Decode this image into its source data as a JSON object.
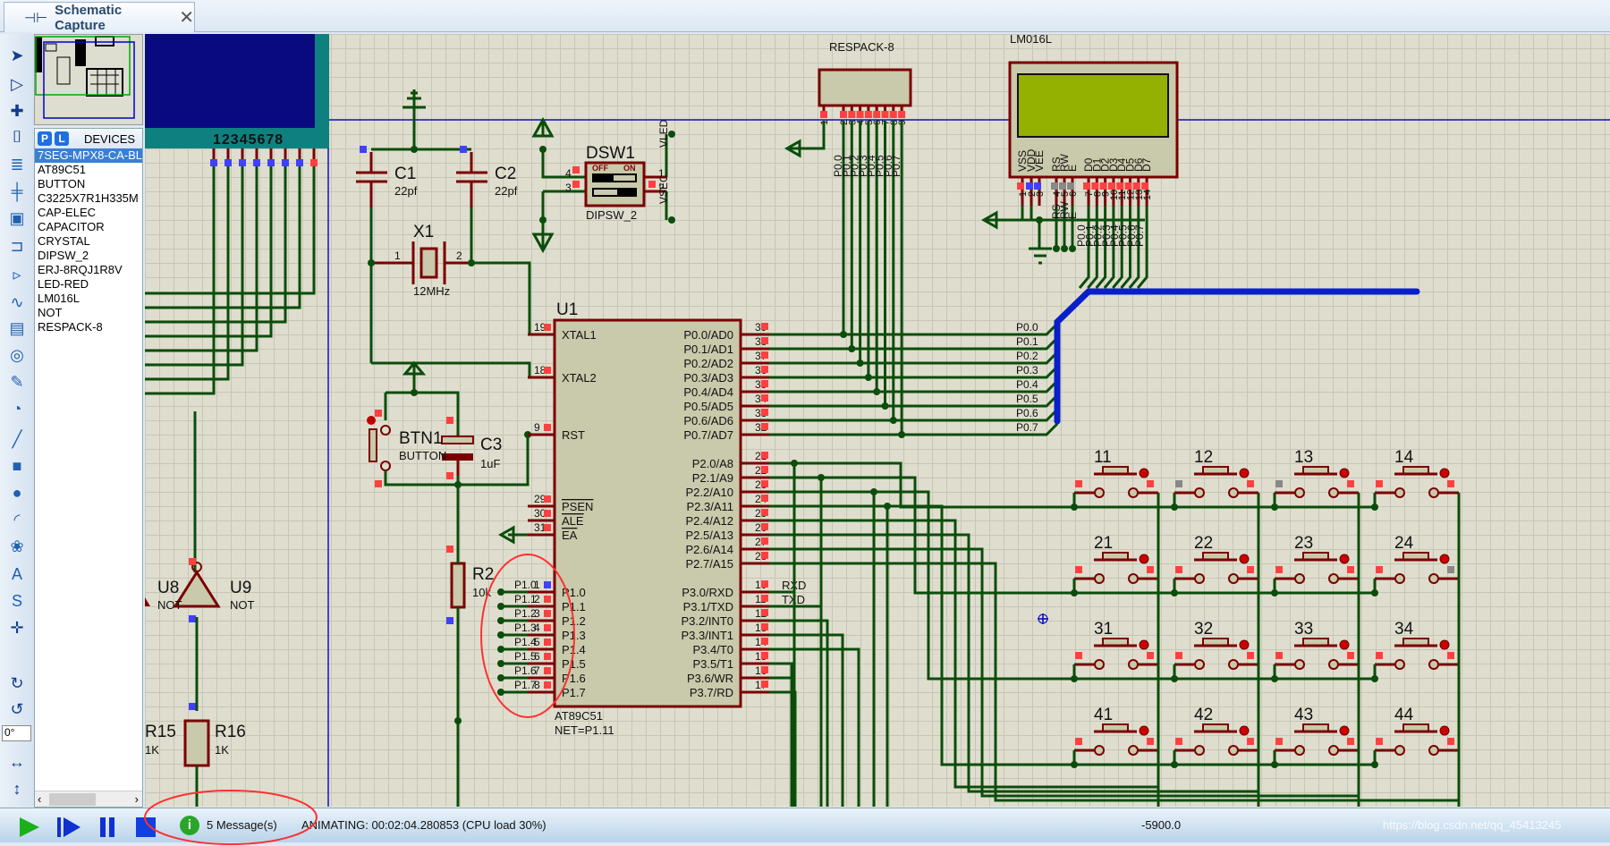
{
  "tab": {
    "title": "Schematic Capture",
    "close": "✕"
  },
  "toolbar": {
    "icons": [
      "pointer-icon",
      "component-icon",
      "junction-icon",
      "label-icon",
      "script-icon",
      "bus-icon",
      "subcircuit-icon",
      "terminal-icon",
      "port-icon",
      "graph-icon",
      "tape-icon",
      "generator-icon",
      "probe-icon",
      "meter-icon",
      "line-icon",
      "box-icon",
      "circle-icon",
      "arc-icon",
      "path-icon",
      "text-icon",
      "symbol-icon",
      "marker-icon",
      "rotate-cw-icon",
      "rotate-ccw-icon",
      "mirror-h-icon",
      "mirror-v-icon"
    ],
    "angle": "0°"
  },
  "devices": {
    "p": "P",
    "l": "L",
    "title": "DEVICES",
    "items": [
      "7SEG-MPX8-CA-BLUE",
      "AT89C51",
      "BUTTON",
      "C3225X7R1H335M",
      "CAP-ELEC",
      "CAPACITOR",
      "CRYSTAL",
      "DIPSW_2",
      "ERJ-8RQJ1R8V",
      "LED-RED",
      "LM016L",
      "NOT",
      "RESPACK-8"
    ],
    "selected": 0
  },
  "schematic": {
    "seg_digits": "12345678",
    "u1": {
      "ref": "U1",
      "part": "AT89C51",
      "net": "NET=P1.11",
      "left": [
        [
          "19",
          "XTAL1"
        ],
        [
          "18",
          "XTAL2"
        ],
        [
          "9",
          "RST"
        ],
        [
          "29",
          "PSEN"
        ],
        [
          "30",
          "ALE"
        ],
        [
          "31",
          "EA"
        ],
        [
          "1",
          "P1.0"
        ],
        [
          "2",
          "P1.1"
        ],
        [
          "3",
          "P1.2"
        ],
        [
          "4",
          "P1.3"
        ],
        [
          "5",
          "P1.4"
        ],
        [
          "6",
          "P1.5"
        ],
        [
          "7",
          "P1.6"
        ],
        [
          "8",
          "P1.7"
        ]
      ],
      "right": [
        [
          "39",
          "P0.0/AD0"
        ],
        [
          "38",
          "P0.1/AD1"
        ],
        [
          "37",
          "P0.2/AD2"
        ],
        [
          "36",
          "P0.3/AD3"
        ],
        [
          "35",
          "P0.4/AD4"
        ],
        [
          "34",
          "P0.5/AD5"
        ],
        [
          "33",
          "P0.6/AD6"
        ],
        [
          "32",
          "P0.7/AD7"
        ],
        [
          "21",
          "P2.0/A8"
        ],
        [
          "22",
          "P2.1/A9"
        ],
        [
          "23",
          "P2.2/A10"
        ],
        [
          "24",
          "P2.3/A11"
        ],
        [
          "25",
          "P2.4/A12"
        ],
        [
          "26",
          "P2.5/A13"
        ],
        [
          "27",
          "P2.6/A14"
        ],
        [
          "28",
          "P2.7/A15"
        ],
        [
          "10",
          "P3.0/RXD"
        ],
        [
          "11",
          "P3.1/TXD"
        ],
        [
          "12",
          "P3.2/INT0"
        ],
        [
          "13",
          "P3.3/INT1"
        ],
        [
          "14",
          "P3.4/T0"
        ],
        [
          "15",
          "P3.5/T1"
        ],
        [
          "16",
          "P3.6/WR"
        ],
        [
          "17",
          "P3.7/RD"
        ]
      ]
    },
    "p1_labels": [
      "P1.0",
      "P1.1",
      "P1.2",
      "P1.3",
      "P1.4",
      "P1.5",
      "P1.6",
      "P1.7"
    ],
    "p0_labels": [
      "P0.0",
      "P0.1",
      "P0.2",
      "P0.3",
      "P0.4",
      "P0.5",
      "P0.6",
      "P0.7"
    ],
    "rxd": "RXD",
    "txd": "TXD",
    "c1": {
      "ref": "C1",
      "value": "22pf"
    },
    "c2": {
      "ref": "C2",
      "value": "22pf"
    },
    "x1": {
      "ref": "X1",
      "value": "12MHz",
      "pin1": "1",
      "pin2": "2"
    },
    "btn1": {
      "ref": "BTN1",
      "value": "BUTTON"
    },
    "c3": {
      "ref": "C3",
      "value": "1uF"
    },
    "dsw1": {
      "ref": "DSW1",
      "value": "DIPSW_2",
      "off": "OFF",
      "on": "ON",
      "vled": "VLED",
      "vsec": "VSEC",
      "pins": [
        "4",
        "3",
        "1",
        "2"
      ]
    },
    "r2": {
      "ref": "R2",
      "value": "10k"
    },
    "u8": {
      "ref": "U8",
      "value": "NOT"
    },
    "u9": {
      "ref": "U9",
      "value": "NOT"
    },
    "r15": {
      "ref": "R15",
      "value": "1K"
    },
    "r16": {
      "ref": "R16",
      "value": "1K"
    },
    "respack": {
      "ref": "RESPACK-8",
      "pins": [
        "1",
        "2",
        "3",
        "4",
        "5",
        "6",
        "7",
        "8",
        "9"
      ]
    },
    "lcd": {
      "ref": "LM016L",
      "pin_names": [
        "VSS",
        "VDD",
        "VEE",
        "RS",
        "RW",
        "E",
        "D0",
        "D1",
        "D2",
        "D3",
        "D4",
        "D5",
        "D6",
        "D7"
      ],
      "pins": [
        "1",
        "2",
        "3",
        "4",
        "5",
        "6",
        "7",
        "8",
        "9",
        "10",
        "11",
        "12",
        "13",
        "14"
      ],
      "ctl_labels": [
        "RS",
        "RW",
        "E"
      ],
      "screen_color": "#94b000"
    },
    "keys": [
      "11",
      "12",
      "13",
      "14",
      "21",
      "22",
      "23",
      "24",
      "31",
      "32",
      "33",
      "34",
      "41",
      "42",
      "43",
      "44"
    ]
  },
  "status": {
    "messages": "5 Message(s)",
    "animating": "ANIMATING: 00:02:04.280853 (CPU load 30%)",
    "coord": "-5900.0",
    "watermark": "https://blog.csdn.net/qq_45413245"
  },
  "colors": {
    "wire": "#0b4d0b",
    "part": "#7a0000",
    "body": "#c9c9ab",
    "bus": "#0a1fc8",
    "pin_red": "#ff4040",
    "pin_blue": "#4040ff",
    "highlight": "#ff3030"
  }
}
